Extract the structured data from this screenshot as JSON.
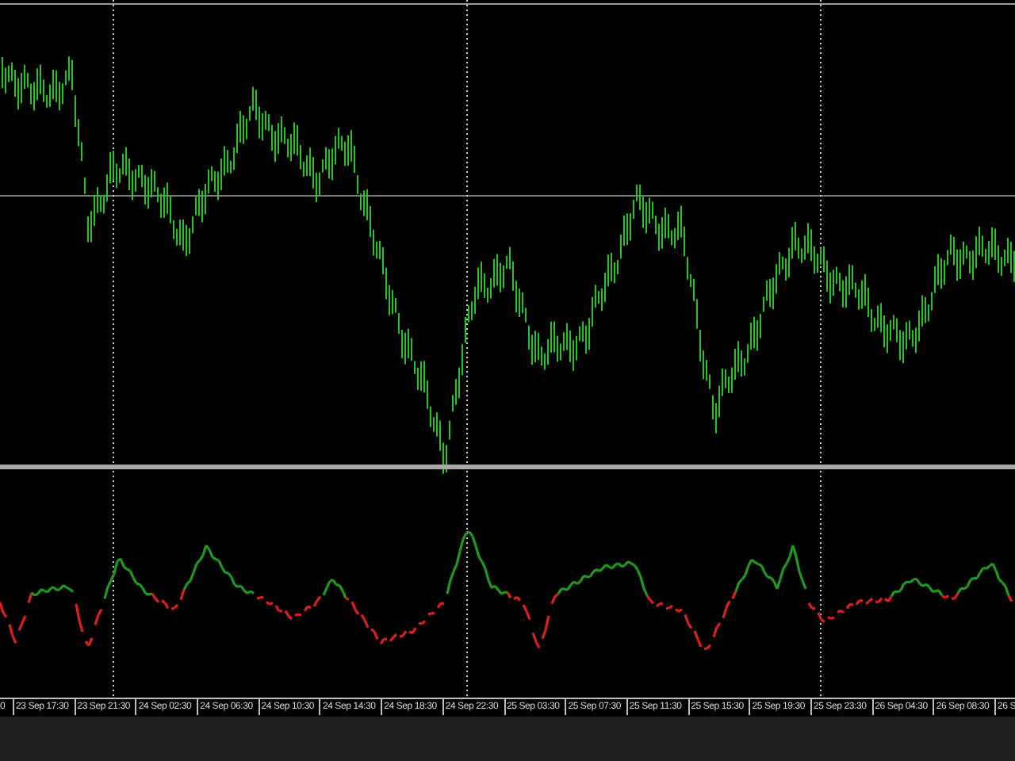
{
  "time_axis": {
    "labels": [
      "0",
      "23 Sep 17:30",
      "23 Sep 21:30",
      "24 Sep 02:30",
      "24 Sep 06:30",
      "24 Sep 10:30",
      "24 Sep 14:30",
      "24 Sep 18:30",
      "24 Sep 22:30",
      "25 Sep 03:30",
      "25 Sep 07:30",
      "25 Sep 11:30",
      "25 Sep 15:30",
      "25 Sep 19:30",
      "25 Sep 23:30",
      "26 Sep 04:30",
      "26 Sep 08:30",
      "26 S"
    ]
  }
}
